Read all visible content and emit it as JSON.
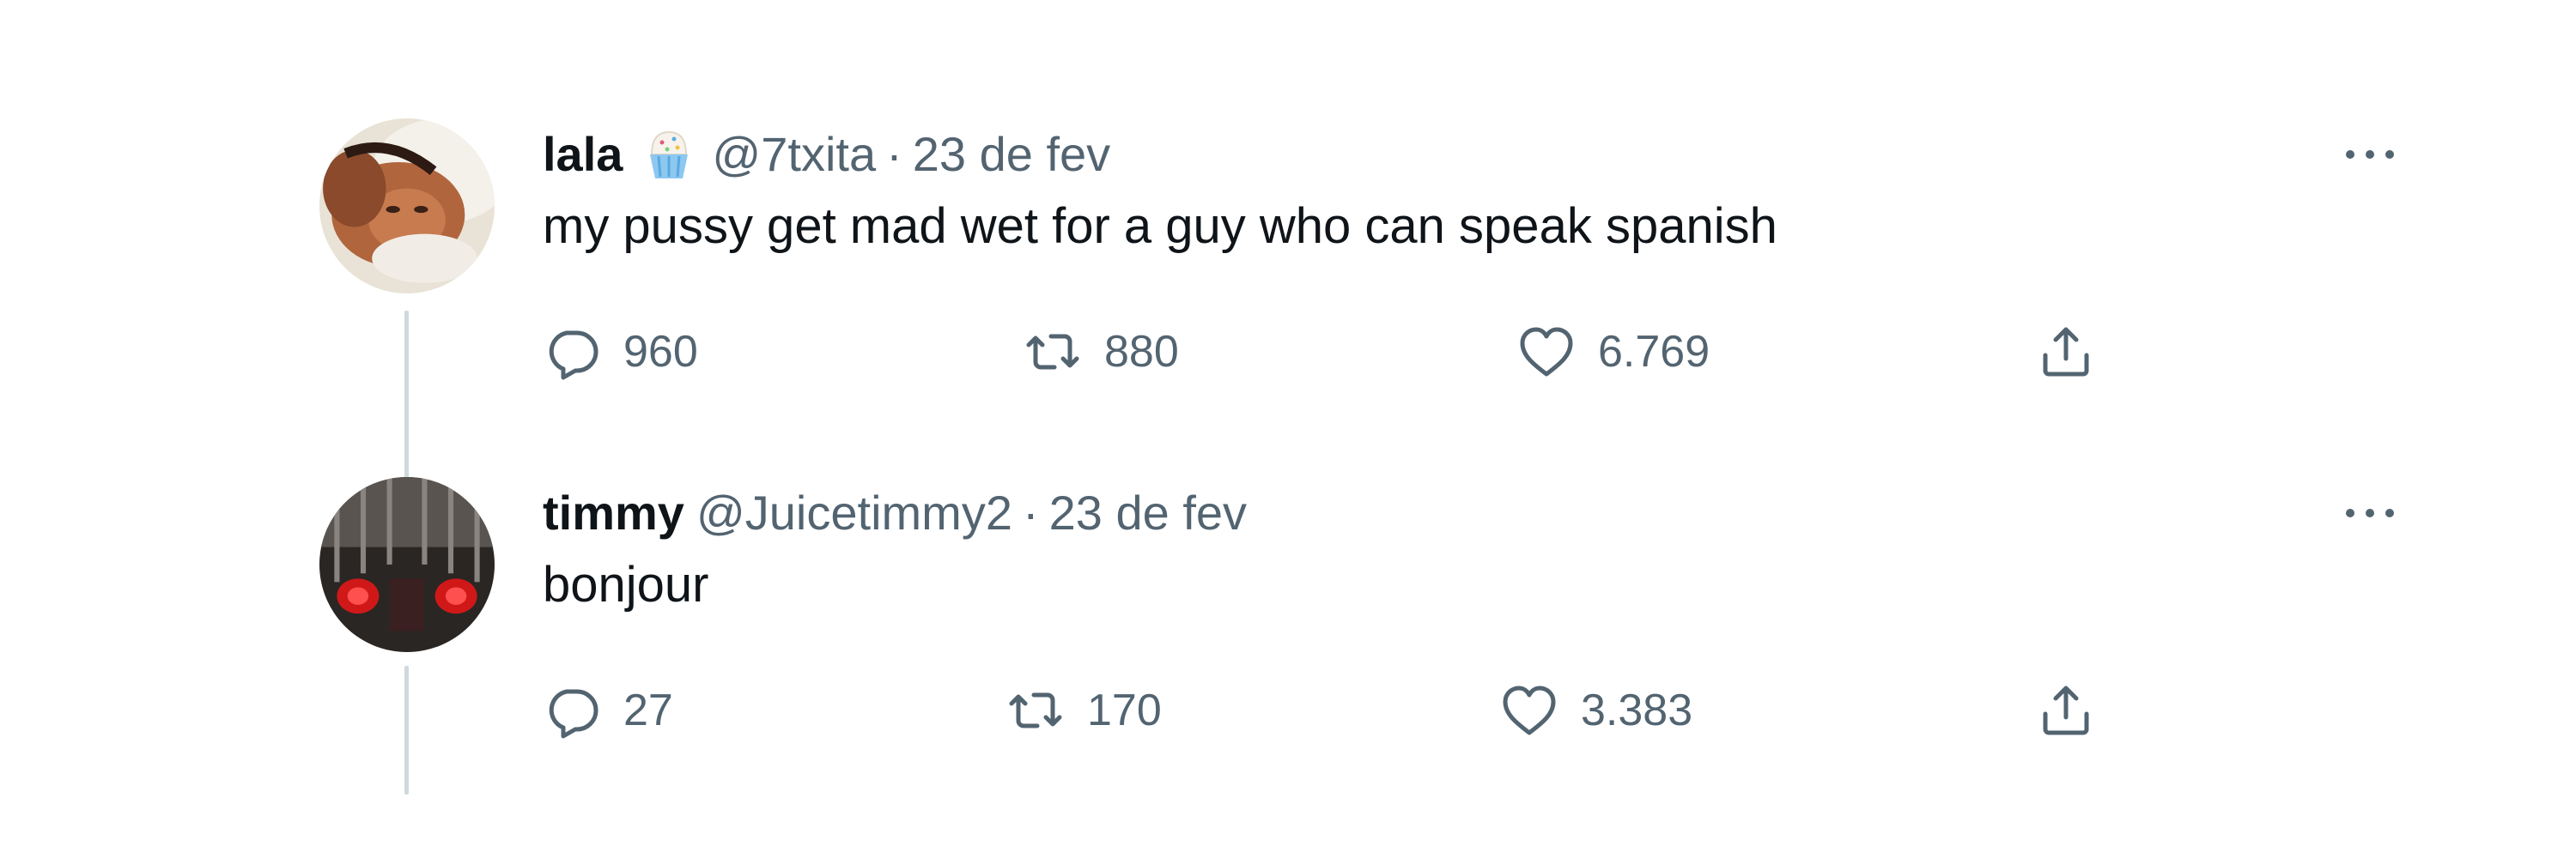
{
  "colors": {
    "text_primary": "#0f1419",
    "text_secondary": "#536471",
    "thread_line": "#cfd9de",
    "background": "#ffffff"
  },
  "tweets": [
    {
      "name": "lala",
      "emoji": "cupcake-emoji",
      "handle": "@7txita",
      "separator": "·",
      "date": "23 de fev",
      "text": "my pussy get mad wet for a guy who can speak spanish",
      "replies": "960",
      "retweets": "880",
      "likes": "6.769",
      "icons": [
        "reply-icon",
        "retweet-icon",
        "like-icon",
        "share-icon",
        "more-icon"
      ]
    },
    {
      "name": "timmy",
      "handle": "@Juicetimmy2",
      "separator": "·",
      "date": "23 de fev",
      "text": "bonjour",
      "replies": "27",
      "retweets": "170",
      "likes": "3.383",
      "icons": [
        "reply-icon",
        "retweet-icon",
        "like-icon",
        "share-icon",
        "more-icon"
      ]
    }
  ]
}
